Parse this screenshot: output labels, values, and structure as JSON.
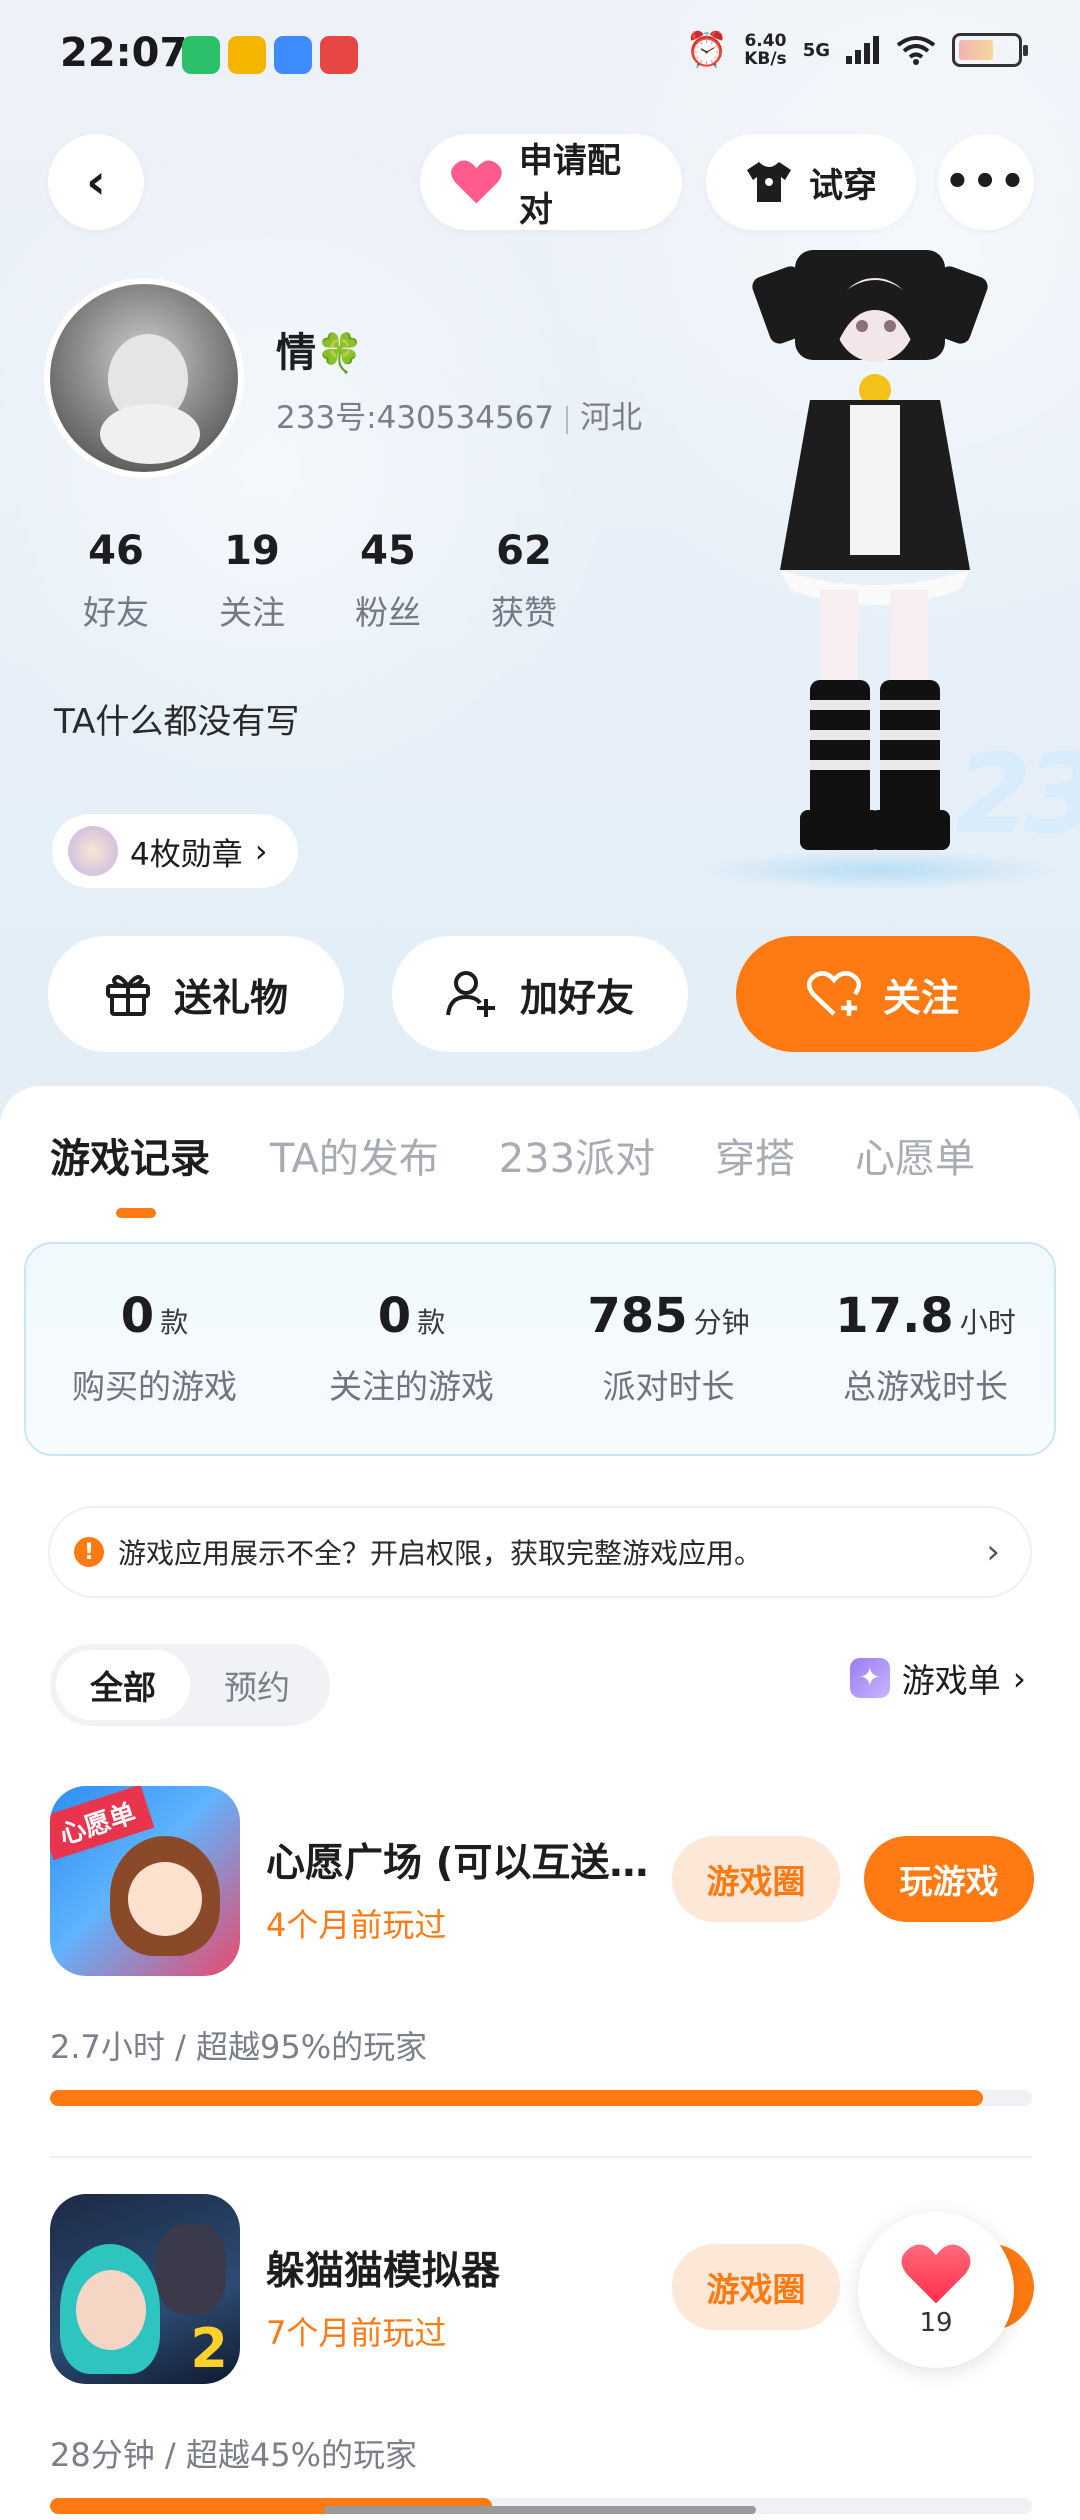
{
  "status_bar": {
    "time": "22:07",
    "net_speed_top": "6.40",
    "net_speed_unit": "KB/s",
    "signal": "5G"
  },
  "top_actions": {
    "pair_label": "申请配对",
    "tryon_label": "试穿"
  },
  "profile": {
    "nickname": "情",
    "id_text": "233号:430534567",
    "region": "河北",
    "stats": [
      {
        "value": "46",
        "label": "好友"
      },
      {
        "value": "19",
        "label": "关注"
      },
      {
        "value": "45",
        "label": "粉丝"
      },
      {
        "value": "62",
        "label": "获赞"
      }
    ],
    "bio": "TA什么都没有写",
    "medal_label": "4枚勋章"
  },
  "actions": {
    "gift": "送礼物",
    "add_friend": "加好友",
    "follow": "关注"
  },
  "tabs": [
    "游戏记录",
    "TA的发布",
    "233派对",
    "穿搭",
    "心愿单"
  ],
  "summary": [
    {
      "value": "0",
      "unit": "款",
      "label": "购买的游戏"
    },
    {
      "value": "0",
      "unit": "款",
      "label": "关注的游戏"
    },
    {
      "value": "785",
      "unit": "分钟",
      "label": "派对时长"
    },
    {
      "value": "17.8",
      "unit": "小时",
      "label": "总游戏时长"
    }
  ],
  "notice": "游戏应用展示不全？开启权限，获取完整游戏应用。",
  "filter": {
    "all": "全部",
    "reserve": "预约"
  },
  "game_list_link": "游戏单",
  "games": [
    {
      "title": "心愿广场 (可以互送…",
      "played": "4个月前玩过",
      "meta": "2.7小时 / 超越95%的玩家",
      "progress": 0.95,
      "circle_btn": "游戏圈",
      "play_btn": "玩游戏",
      "icon_badge": "心愿单"
    },
    {
      "title": "躲猫猫模拟器",
      "played": "7个月前玩过",
      "meta": "28分钟 / 超越45%的玩家",
      "progress": 0.45,
      "circle_btn": "游戏圈",
      "icon_badge": "2"
    }
  ],
  "floating_like_count": "19",
  "colors": {
    "accent": "#ff7a12",
    "accent_light": "#fde7d6",
    "text_muted": "#7a7f8a"
  }
}
